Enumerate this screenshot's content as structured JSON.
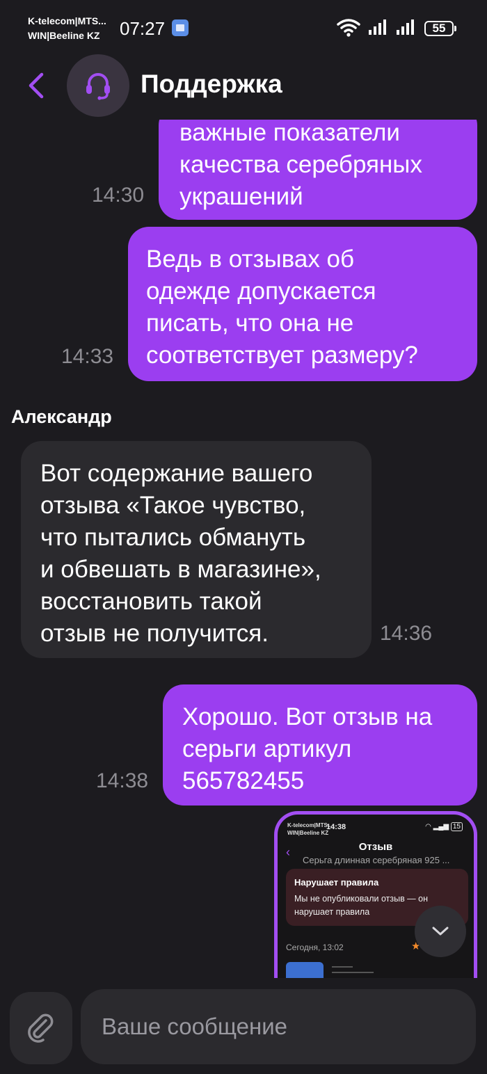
{
  "status_bar": {
    "carrier_line1": "K-telecom|MTS...",
    "carrier_line2": "WIN|Beeline KZ",
    "time": "07:27",
    "battery": "55"
  },
  "header": {
    "title": "Поддержка"
  },
  "messages": [
    {
      "text": "важные показатели\nкачества серебряных\nукрашений",
      "time": "14:30"
    },
    {
      "text": "Ведь в отзывах об\nодежде допускается\nписать, что она не\nсоответствует размеру?",
      "time": "14:33"
    },
    {
      "sender": "Александр",
      "text": "Вот содержание вашего\nотзыва «Такое чувство,\nчто пытались обмануть\nи обвешать в магазине»,\nвосстановить такой\nотзыв не получится.",
      "time": "14:36"
    },
    {
      "text": "Хорошо. Вот отзыв на\nсерьги артикул\n565782455",
      "time": "14:38"
    }
  ],
  "attachment": {
    "carrier_line1": "K-telecom|MTS...",
    "carrier_line2": "WIN|Beeline KZ",
    "time": "14:38",
    "battery": "15",
    "title": "Отзыв",
    "subtitle": "Серьга длинная серебряная 925 ...",
    "notice_title": "Нарушает правила",
    "notice_text": "Мы не опубликовали отзыв — он нарушает правила",
    "date": "Сегодня, 13:02"
  },
  "input": {
    "placeholder": "Ваше сообщение"
  },
  "colors": {
    "background": "#1c1b1f",
    "outgoing_bubble": "#9b3ef0",
    "incoming_bubble": "#2b2a2e",
    "accent": "#a24ef2"
  }
}
